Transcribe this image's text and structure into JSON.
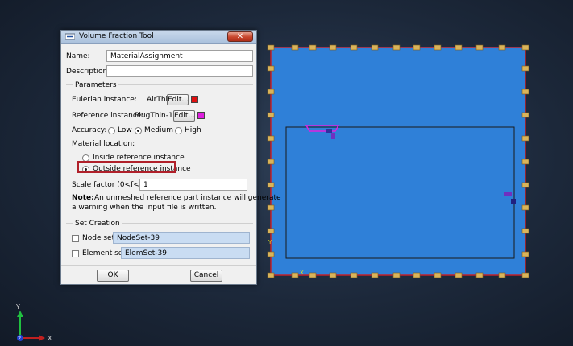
{
  "dialog": {
    "title": "Volume Fraction Tool",
    "name_label": "Name:",
    "name_value": "MaterialAssignment",
    "description_label": "Description:",
    "description_value": "",
    "parameters_heading": "Parameters",
    "eulerian_label": "Eulerian instance:",
    "eulerian_value": "AirThin-1",
    "eulerian_edit": "Edit...",
    "eulerian_color": "#e01010",
    "reference_label": "Reference instance:",
    "reference_value": "PlugThin-1",
    "reference_edit": "Edit...",
    "reference_color": "#e020e0",
    "accuracy_label": "Accuracy:",
    "accuracy_options": [
      "Low",
      "Medium",
      "High"
    ],
    "accuracy_selected": "Medium",
    "material_location_label": "Material location:",
    "location_options": [
      "Inside reference instance",
      "Outside reference instance"
    ],
    "location_selected": "Outside reference instance",
    "scale_label": "Scale factor (0<f<=1):",
    "scale_value": "1",
    "note_label": "Note:",
    "note_line1": "An unmeshed reference part instance will generate",
    "note_line2": "a warning when the input file is written.",
    "set_creation_heading": "Set Creation",
    "node_set_label": "Node set:",
    "node_set_value": "NodeSet-39",
    "element_set_label": "Element set:",
    "element_set_value": "ElemSet-39",
    "ok_label": "OK",
    "cancel_label": "Cancel",
    "close_symbol": "✕"
  },
  "viewport": {
    "background_color": "#1c283a",
    "part_color": "#2f80d8",
    "border_color": "#c0202a",
    "marker_color": "#d9b45a",
    "inner_frame_color": "#1a1a1a",
    "axis_x_label": "X",
    "axis_y_label": "Y",
    "axis_z_label": "Z"
  }
}
